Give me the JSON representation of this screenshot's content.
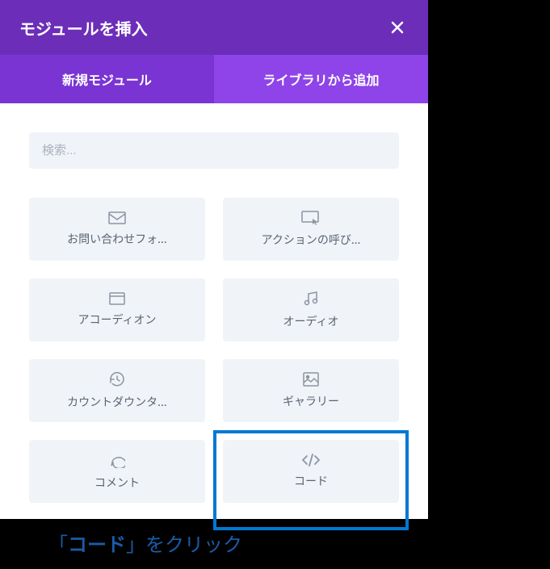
{
  "header": {
    "title": "モジュールを挿入"
  },
  "tabs": {
    "new_module": "新規モジュール",
    "from_library": "ライブラリから追加"
  },
  "search": {
    "placeholder": "検索..."
  },
  "modules": {
    "contact_form": "お問い合わせフォ...",
    "call_to_action": "アクションの呼び...",
    "accordion": "アコーディオン",
    "audio": "オーディオ",
    "countdown": "カウントダウンタ...",
    "gallery": "ギャラリー",
    "comment": "コメント",
    "code": "コード"
  },
  "annotation": {
    "prefix": "「",
    "bold": "コード",
    "suffix": "」をクリック"
  }
}
